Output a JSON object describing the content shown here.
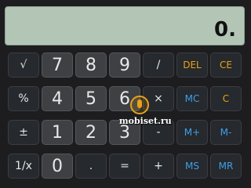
{
  "display": {
    "value": "0."
  },
  "keys": {
    "sqrt": "√",
    "seven": "7",
    "eight": "8",
    "nine": "9",
    "divide": "/",
    "del": "DEL",
    "ce": "CE",
    "percent": "%",
    "four": "4",
    "five": "5",
    "six": "6",
    "multiply": "×",
    "mc": "MC",
    "c": "C",
    "plusminus": "±",
    "one": "1",
    "two": "2",
    "three": "3",
    "minus": "-",
    "mplus": "M+",
    "mminus": "M-",
    "reciprocal": "1/x",
    "zero": "0",
    "dot": ".",
    "equals": "=",
    "plus": "+",
    "ms": "MS",
    "mr": "MR"
  },
  "watermark": "mobiset.ru",
  "colors": {
    "blue": "#3f9fe8",
    "orange": "#e7a21a",
    "display_bg": "#b3c5b5"
  }
}
